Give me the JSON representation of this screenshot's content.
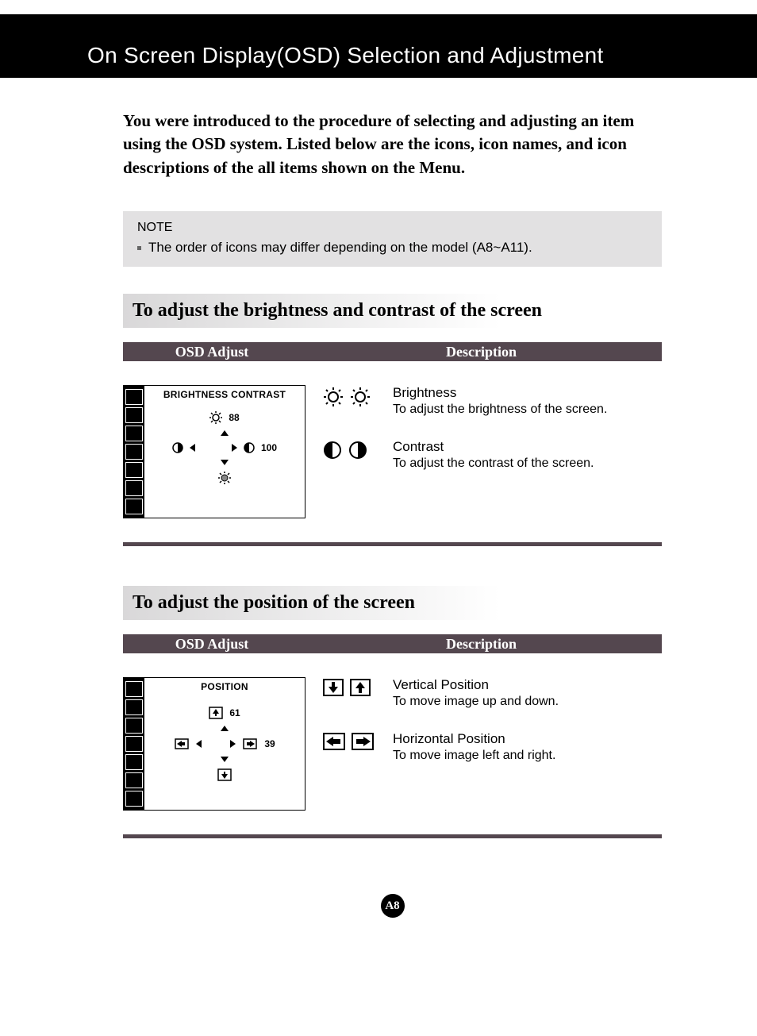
{
  "header": {
    "title": "On Screen Display(OSD) Selection and Adjustment"
  },
  "intro": "You were introduced to the procedure of selecting and adjusting an item using the OSD system.  Listed below are the icons, icon names, and icon descriptions of the all items shown on the Menu.",
  "note": {
    "label": "NOTE",
    "text": "The order of icons may differ depending on the model (A8~A11)."
  },
  "columns": {
    "left": "OSD Adjust",
    "right": "Description"
  },
  "section1": {
    "heading": "To adjust the brightness and contrast of the screen",
    "osd": {
      "title": "BRIGHTNESS CONTRAST",
      "brightness_val": "88",
      "contrast_val": "100"
    },
    "items": [
      {
        "name": "Brightness",
        "desc": "To adjust the brightness of the screen."
      },
      {
        "name": "Contrast",
        "desc": "To adjust the contrast of the screen."
      }
    ]
  },
  "section2": {
    "heading": "To adjust the position of the screen",
    "osd": {
      "title": "POSITION",
      "v_val": "61",
      "h_val": "39"
    },
    "items": [
      {
        "name": "Vertical Position",
        "desc": "To move image up and down."
      },
      {
        "name": "Horizontal Position",
        "desc": "To move image left and right."
      }
    ]
  },
  "page_number": "A8"
}
